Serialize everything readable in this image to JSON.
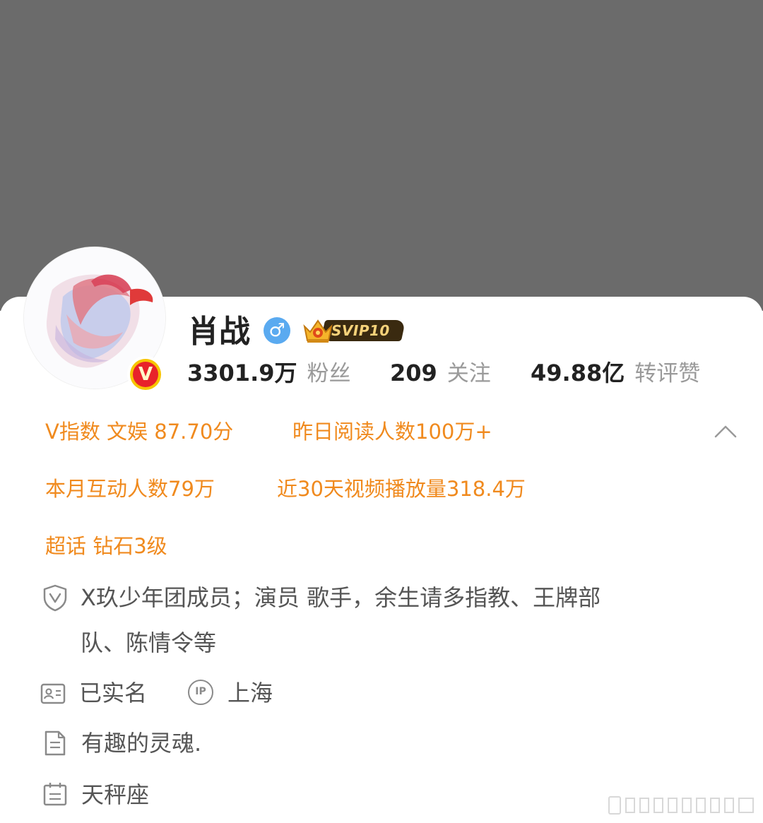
{
  "profile": {
    "name": "肖战",
    "gender_icon": "male-icon",
    "vip_label": "SVIP10",
    "verified_badge": "V",
    "stats": [
      {
        "value": "3301.9万",
        "label": "粉丝"
      },
      {
        "value": "209",
        "label": "关注"
      },
      {
        "value": "49.88亿",
        "label": "转评赞"
      }
    ]
  },
  "highlights": {
    "v_index": "V指数 文娱 87.70分",
    "yesterday_reads": "昨日阅读人数100万+",
    "monthly_interactions": "本月互动人数79万",
    "video_plays": "近30天视频播放量318.4万",
    "super_topic": "超话 钻石3级"
  },
  "info": {
    "verification_line1": "X玖少年团成员；演员 歌手，余生请多指教、王牌部",
    "verification_line2": "队、陈情令等",
    "real_name": "已实名",
    "ip_label": "IP",
    "ip_location": "上海",
    "bio": "有趣的灵魂.",
    "zodiac": "天秤座"
  },
  "colors": {
    "cover": "#6b6b6b",
    "accent_orange": "#f08a1e",
    "gender_blue": "#5aaaf0",
    "badge_red": "#e8222a",
    "badge_gold": "#f7c500"
  }
}
